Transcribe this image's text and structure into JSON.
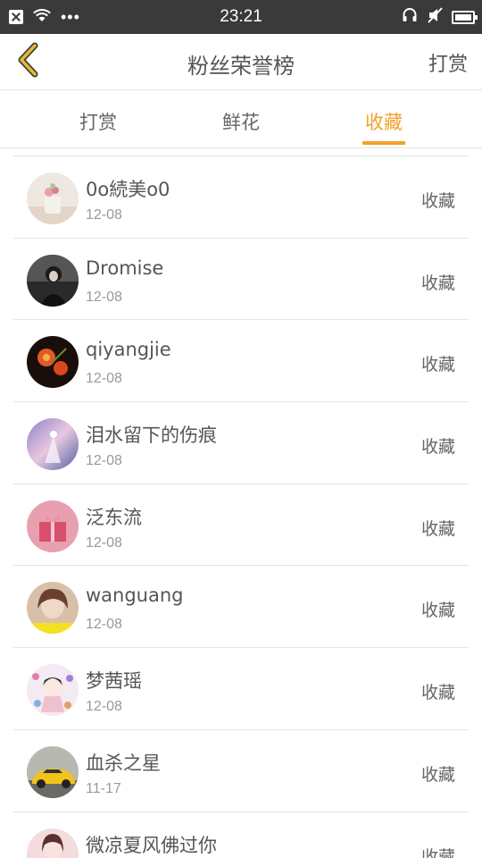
{
  "status_bar": {
    "time": "23:21",
    "icons": [
      "close-icon",
      "wifi-icon",
      "more-dots-icon",
      "headset-icon",
      "mute-icon",
      "battery-icon"
    ],
    "dots": "•••"
  },
  "header": {
    "title": "粉丝荣誉榜",
    "right_action": "打赏",
    "back_icon": "chevron-left-icon",
    "accent_color": "#f0a22a"
  },
  "tabs": [
    {
      "label": "打赏",
      "active": false
    },
    {
      "label": "鲜花",
      "active": false
    },
    {
      "label": "收藏",
      "active": true
    }
  ],
  "list": {
    "items": [
      {
        "name": "0o続美o0",
        "date": "12-08",
        "action": "收藏"
      },
      {
        "name": "Dromise",
        "date": "12-08",
        "action": "收藏"
      },
      {
        "name": "qiyangjie",
        "date": "12-08",
        "action": "收藏"
      },
      {
        "name": "泪水留下的伤痕",
        "date": "12-08",
        "action": "收藏"
      },
      {
        "name": "泛东流",
        "date": "12-08",
        "action": "收藏"
      },
      {
        "name": "wanguang",
        "date": "12-08",
        "action": "收藏"
      },
      {
        "name": "梦茜瑶",
        "date": "12-08",
        "action": "收藏"
      },
      {
        "name": "血杀之星",
        "date": "11-17",
        "action": "收藏"
      },
      {
        "name": "微凉夏风佛过你",
        "date": "",
        "action": "收藏"
      }
    ]
  }
}
